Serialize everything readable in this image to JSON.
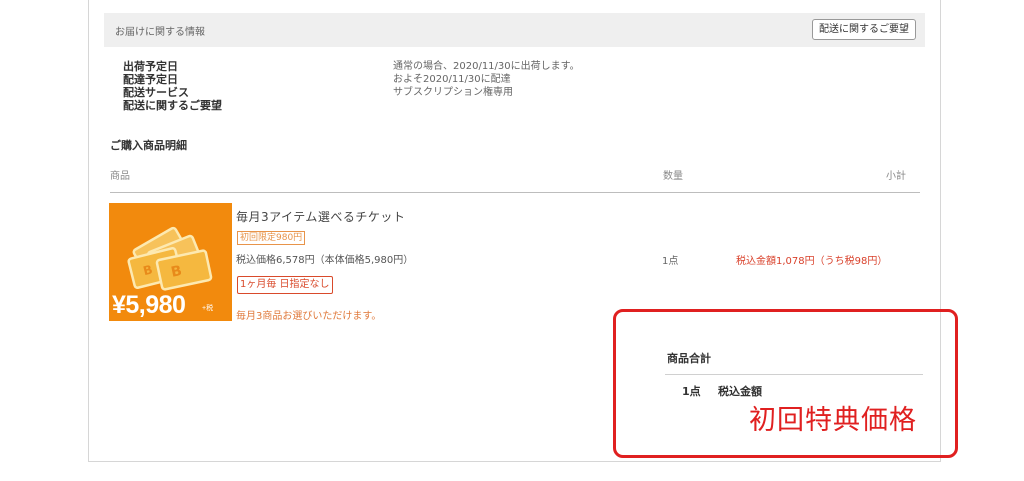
{
  "delivery": {
    "header_title": "お届けに関する情報",
    "request_button": "配送に関するご要望",
    "rows": [
      {
        "label": "出荷予定日",
        "value": "通常の場合、2020/11/30に出荷します。"
      },
      {
        "label": "配達予定日",
        "value": "およそ2020/11/30に配達"
      },
      {
        "label": "配送サービス",
        "value": "サブスクリプション権専用"
      },
      {
        "label": "配送に関するご要望",
        "value": ""
      }
    ]
  },
  "order": {
    "section_title": "ご購入商品明細",
    "columns": {
      "product": "商品",
      "quantity": "数量",
      "subtotal": "小計"
    },
    "item": {
      "thumbnail_price": "¥5,980",
      "thumbnail_tax": "+税",
      "name": "毎月3アイテム選べるチケット",
      "first_badge": "初回限定980円",
      "tax_price": "税込価格6,578円（本体価格5,980円）",
      "monthly_badge": "1ヶ月毎 日指定なし",
      "note": "毎月3商品お選びいただけます。",
      "quantity": "1点",
      "subtotal": "税込金額1,078円（うち税98円）"
    }
  },
  "summary": {
    "title": "商品合計",
    "quantity": "1点",
    "total_label": "税込金額",
    "annotation": "初回特典価格"
  },
  "colors": {
    "accent_red": "#e02020",
    "orange": "#f28a0d",
    "price_red": "#d9412b"
  }
}
